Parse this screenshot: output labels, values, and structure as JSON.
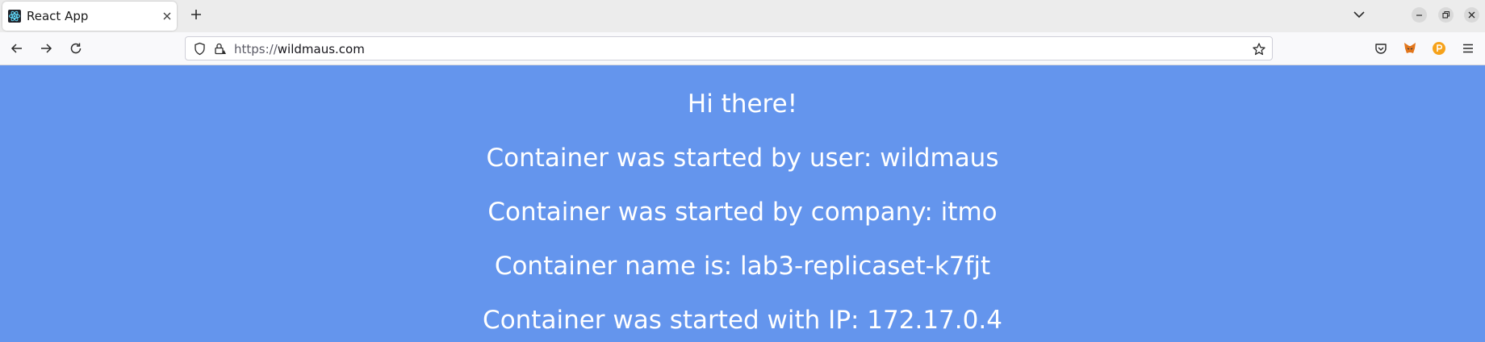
{
  "browser": {
    "tab": {
      "title": "React App",
      "favicon_icon": "react-icon"
    },
    "new_tab_icon": "plus-icon",
    "tab_list_icon": "chevron-down-icon",
    "window_controls": [
      "minimize-icon",
      "restore-icon",
      "close-icon"
    ],
    "nav": {
      "back_icon": "arrow-left-icon",
      "forward_icon": "arrow-right-icon",
      "reload_icon": "reload-icon"
    },
    "url": {
      "scheme": "https://",
      "host": "wildmaus.com"
    },
    "extensions": [
      "pocket-icon",
      "metamask-fox-icon",
      "orange-p-extension-icon"
    ],
    "menu_icon": "hamburger-menu-icon"
  },
  "page": {
    "background_color": "#6495ed",
    "greeting": "Hi there!",
    "lines": [
      "Container was started by user: wildmaus",
      "Container was started by company: itmo",
      "Container name is: lab3-replicaset-k7fjt",
      "Container was started with IP: 172.17.0.4"
    ]
  }
}
